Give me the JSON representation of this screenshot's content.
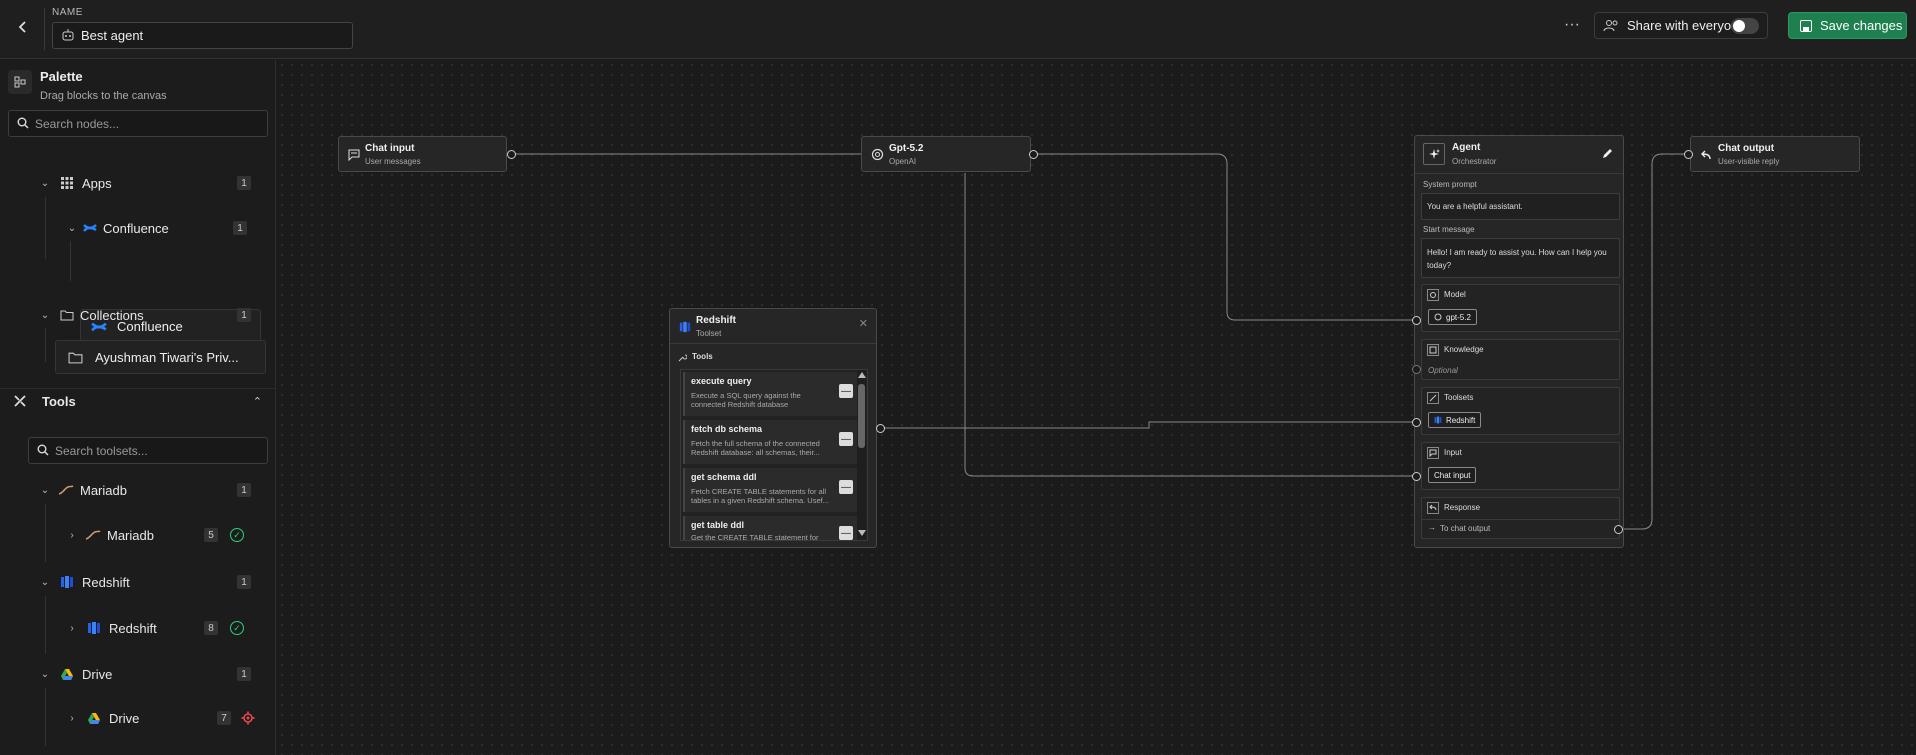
{
  "header": {
    "name_label": "NAME",
    "agent_name": "Best agent",
    "share_label": "Share with everyone",
    "save_label": "Save changes",
    "share_enabled": false
  },
  "sidebar": {
    "palette_title": "Palette",
    "palette_subtitle": "Drag blocks to the canvas",
    "search_nodes_placeholder": "Search nodes...",
    "apps_label": "Apps",
    "apps_count": "1",
    "confluence_group": "Confluence",
    "confluence_group_count": "1",
    "confluence_item": "Confluence",
    "collections_label": "Collections",
    "collections_count": "1",
    "collection_item": "Ayushman Tiwari's Priv...",
    "tools_label": "Tools",
    "search_toolsets_placeholder": "Search toolsets...",
    "toolsets": [
      {
        "group": "Mariadb",
        "group_count": "1",
        "item": "Mariadb",
        "item_count": "5",
        "status": "ok"
      },
      {
        "group": "Redshift",
        "group_count": "1",
        "item": "Redshift",
        "item_count": "8",
        "status": "ok"
      },
      {
        "group": "Drive",
        "group_count": "1",
        "item": "Drive",
        "item_count": "7",
        "status": "error"
      }
    ]
  },
  "canvas": {
    "chat_input": {
      "title": "Chat input",
      "subtitle": "User messages"
    },
    "model_node": {
      "title": "Gpt-5.2",
      "subtitle": "OpenAI"
    },
    "chat_output": {
      "title": "Chat output",
      "subtitle": "User-visible reply"
    },
    "agent": {
      "title": "Agent",
      "subtitle": "Orchestrator",
      "system_prompt_label": "System prompt",
      "system_prompt": "You are a helpful assistant.",
      "start_message_label": "Start message",
      "start_message": "Hello! I am ready to assist you. How can I help you today?",
      "model_label": "Model",
      "model_value": "gpt-5.2",
      "knowledge_label": "Knowledge",
      "knowledge_value": "Optional",
      "toolsets_label": "Toolsets",
      "toolsets_value": "Redshift",
      "input_label": "Input",
      "input_value": "Chat input",
      "response_label": "Response",
      "response_value": "To chat output"
    },
    "redshift": {
      "title": "Redshift",
      "subtitle": "Toolset",
      "tools_label": "Tools",
      "tools": [
        {
          "name": "execute query",
          "desc": "Execute a SQL query against the connected Redshift database"
        },
        {
          "name": "fetch db schema",
          "desc": "Fetch the full schema of the connected Redshift database: all schemas, their..."
        },
        {
          "name": "get schema ddl",
          "desc": "Fetch CREATE TABLE statements for all tables in a given Redshift schema. Usef..."
        },
        {
          "name": "get table ddl",
          "desc": "Get the CREATE TABLE statement for a..."
        }
      ]
    }
  },
  "colors": {
    "accent_green": "#1e7f4f",
    "ok_green": "#2bd17e",
    "error_red": "#e5484d",
    "confluence_blue": "#2684ff",
    "redshift_blue": "#3b82f6"
  }
}
